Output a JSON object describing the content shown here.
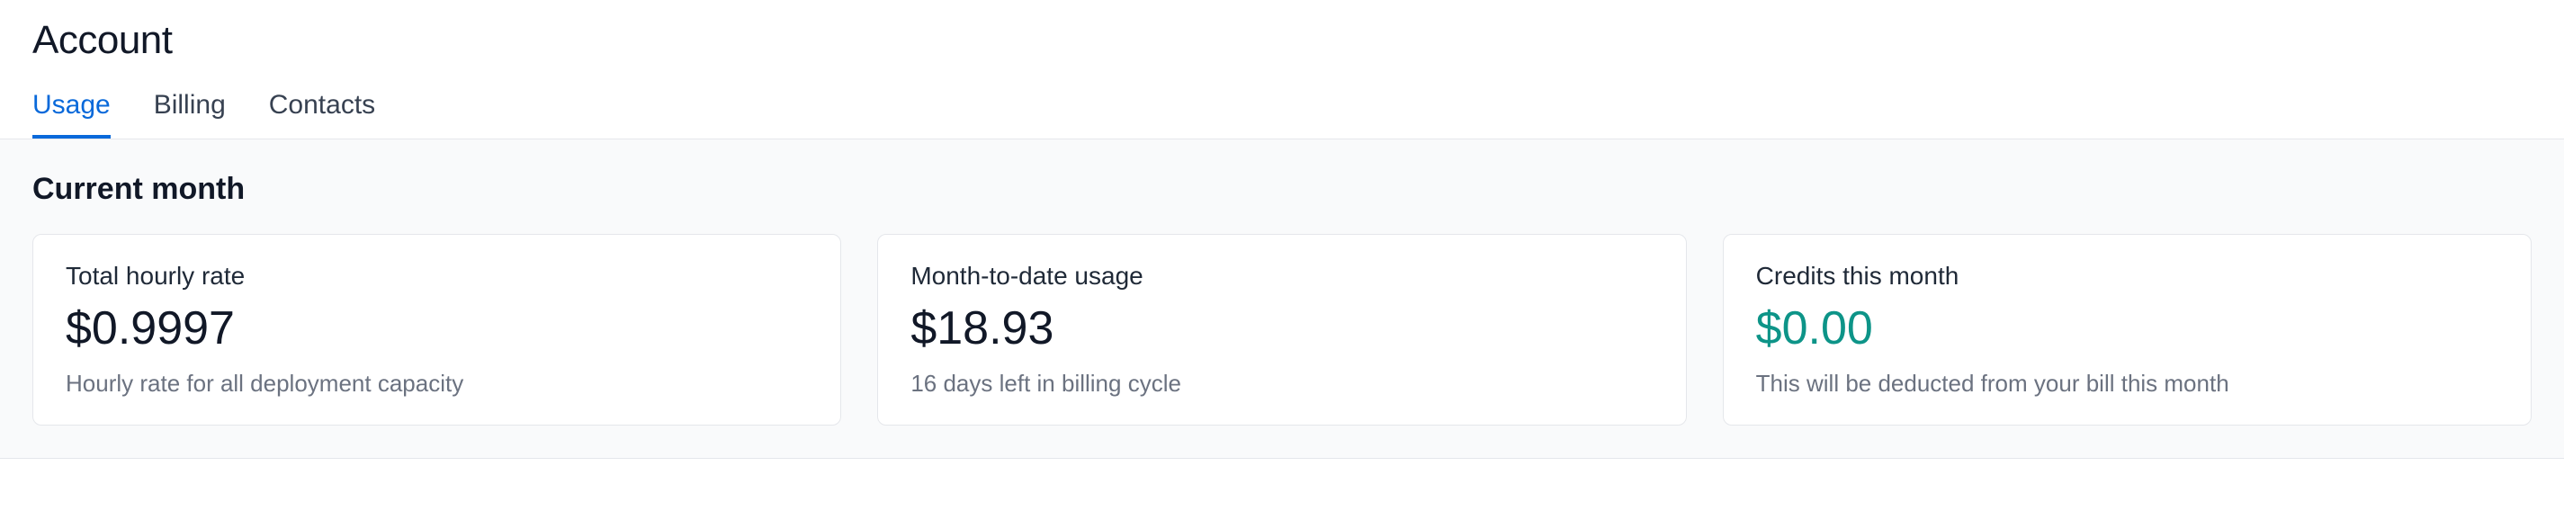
{
  "header": {
    "title": "Account"
  },
  "tabs": [
    {
      "label": "Usage",
      "active": true
    },
    {
      "label": "Billing",
      "active": false
    },
    {
      "label": "Contacts",
      "active": false
    }
  ],
  "section": {
    "title": "Current month"
  },
  "cards": [
    {
      "label": "Total hourly rate",
      "value": "$0.9997",
      "sub": "Hourly rate for all deployment capacity",
      "color": "default"
    },
    {
      "label": "Month-to-date usage",
      "value": "$18.93",
      "sub": "16 days left in billing cycle",
      "color": "default"
    },
    {
      "label": "Credits this month",
      "value": "$0.00",
      "sub": "This will be deducted from your bill this month",
      "color": "green"
    }
  ]
}
